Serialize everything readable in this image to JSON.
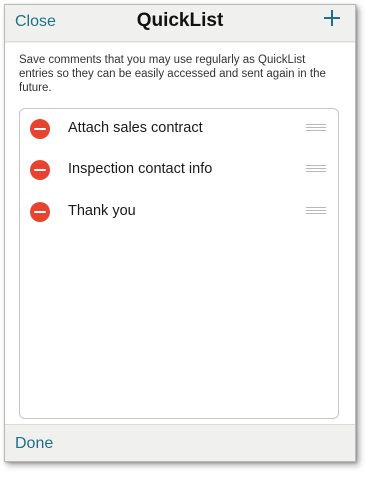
{
  "navbar": {
    "close_label": "Close",
    "title": "QuickList",
    "add_icon": "plus-icon"
  },
  "description": "Save comments that you may use regularly as QuickList entries so they can be easily accessed and sent again in the future.",
  "list": {
    "items": [
      {
        "label": "Attach sales contract"
      },
      {
        "label": "Inspection contact info"
      },
      {
        "label": "Thank you"
      }
    ]
  },
  "toolbar": {
    "done_label": "Done"
  },
  "colors": {
    "accent": "#1f6f8b",
    "delete": "#e8432f",
    "bar_background": "#f0f1ef"
  }
}
